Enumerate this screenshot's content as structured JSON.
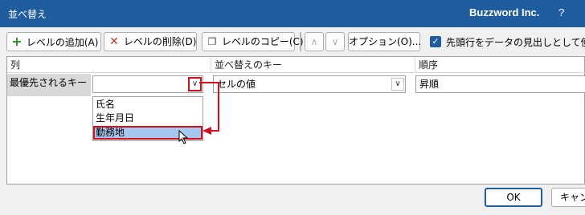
{
  "window": {
    "title": "並べ替え",
    "brand": "Buzzword Inc.",
    "help": "?"
  },
  "toolbar": {
    "add_level": "レベルの追加(A)",
    "delete_level": "レベルの削除(D)",
    "copy_level": "レベルのコピー(C)",
    "move_up": "∧",
    "move_down": "∨",
    "options": "オプション(O)...",
    "header_checkbox_label": "先頭行をデータの見出しとして使用す"
  },
  "grid": {
    "headers": [
      "列",
      "並べ替えのキー",
      "順序"
    ],
    "rows": [
      {
        "label": "最優先されるキー",
        "column_value": "",
        "sort_on": "セルの値",
        "order": "昇順"
      }
    ]
  },
  "dropdown": {
    "options": [
      "氏名",
      "生年月日",
      "勤務地"
    ],
    "highlighted": "勤務地"
  },
  "footer": {
    "ok": "OK",
    "cancel": "キャン"
  },
  "colors": {
    "titlebar": "#1f5d9e",
    "annotation": "#d10f1f",
    "highlight": "#a6c8ee"
  }
}
